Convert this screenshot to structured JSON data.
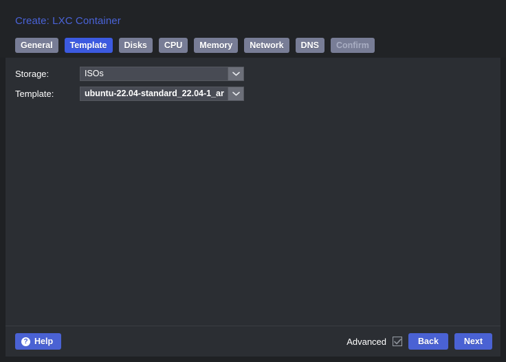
{
  "window": {
    "title": "Create: LXC Container",
    "close_icon": "close-icon"
  },
  "tabs": [
    {
      "label": "General",
      "state": "normal"
    },
    {
      "label": "Template",
      "state": "active"
    },
    {
      "label": "Disks",
      "state": "normal"
    },
    {
      "label": "CPU",
      "state": "normal"
    },
    {
      "label": "Memory",
      "state": "normal"
    },
    {
      "label": "Network",
      "state": "normal"
    },
    {
      "label": "DNS",
      "state": "normal"
    },
    {
      "label": "Confirm",
      "state": "disabled"
    }
  ],
  "form": {
    "storage": {
      "label": "Storage:",
      "value": "ISOs",
      "trigger_icon": "chevron-down-icon"
    },
    "template": {
      "label": "Template:",
      "value": "ubuntu-22.04-standard_22.04-1_ar",
      "trigger_icon": "chevron-down-icon"
    }
  },
  "footer": {
    "help_label": "Help",
    "help_icon": "question-mark-icon",
    "advanced_label": "Advanced",
    "advanced_checked": true,
    "back_label": "Back",
    "next_label": "Next"
  },
  "colors": {
    "accent": "#4a62d4",
    "tab_active": "#3c5ae0",
    "tab_inactive": "#787d96",
    "title": "#4a63d8",
    "frame": "#1f2124",
    "header": "#212326",
    "body": "#2b2e33",
    "field": "#484b54",
    "field_trigger": "#6c6f79"
  }
}
